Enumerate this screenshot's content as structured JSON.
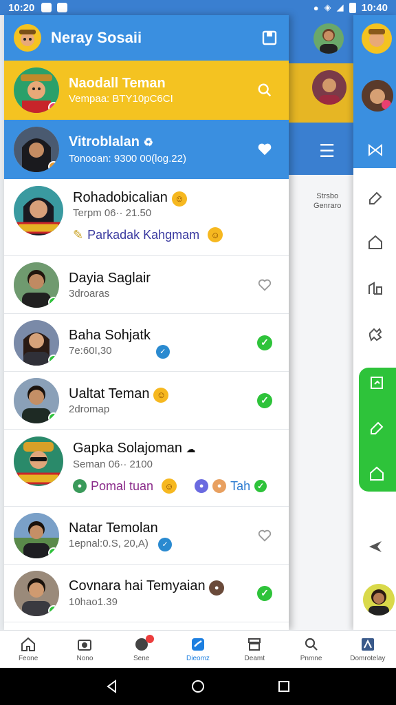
{
  "status_bar": {
    "time_left": "10:20",
    "time_right": "10:40"
  },
  "header": {
    "title": "Neray Sosaii"
  },
  "chats": [
    {
      "name": "Naodall Teman",
      "sub": "Vempaa: BTY10pC6CI",
      "style": "yellow",
      "action_icon": "search-icon"
    },
    {
      "name": "Vitroblalan",
      "sub": "Tonooan: 9300 00(log.22)",
      "style": "blue",
      "action_icon": "heart-icon",
      "name_suffix": "♻"
    },
    {
      "name": "Rohadobicalian",
      "sub": "Terpm 06·· 21.50",
      "style": "plain",
      "extra_text": "Parkadak Kahgmam",
      "extra_color": "#3a3aa0",
      "action_icon": ""
    },
    {
      "name": "Dayia Saglair",
      "sub": "3droaras",
      "style": "plain",
      "action_icon": "heart-outline-icon"
    },
    {
      "name": "Baha Sohjatk",
      "sub": "7е:60I,30",
      "style": "plain",
      "action_icon": "check-icon"
    },
    {
      "name": "Ualtat Teman",
      "sub": "2dromap",
      "style": "plain",
      "action_icon": "check-icon"
    },
    {
      "name": "Gapka Solajoman",
      "sub": "Seman 06·· 2100",
      "style": "plain",
      "extra_text": "Pomal tuan",
      "extra_color": "#8a2a8a",
      "extra_text2": "Tah",
      "extra_color2": "#2a7ad0",
      "action_icon": ""
    },
    {
      "name": "Natar Temolan",
      "sub": "1epnal:0.S, 20,A)",
      "style": "plain",
      "action_icon": "heart-outline-icon"
    },
    {
      "name": "Covnara hai Temyaian",
      "sub": "10hao1.39",
      "style": "plain",
      "action_icon": "check-icon"
    }
  ],
  "background_app": {
    "note_line1": "Strsbo",
    "note_line2": "Genraro"
  },
  "bottom_nav": [
    {
      "label": "Feone",
      "icon": "home-icon"
    },
    {
      "label": "Nono",
      "icon": "camera-icon"
    },
    {
      "label": "Sene",
      "icon": "chat-icon"
    },
    {
      "label": "Dieomz",
      "icon": "contacts-icon",
      "active": true
    },
    {
      "label": "Deamt",
      "icon": "archive-icon"
    },
    {
      "label": "Pnmne",
      "icon": "search-icon"
    },
    {
      "label": "Domrotelay",
      "icon": "settings-icon"
    }
  ],
  "colors": {
    "primary": "#3a8fe0",
    "highlight": "#f4c321",
    "online": "#2ec33a",
    "active_nav": "#1d7fe0"
  }
}
